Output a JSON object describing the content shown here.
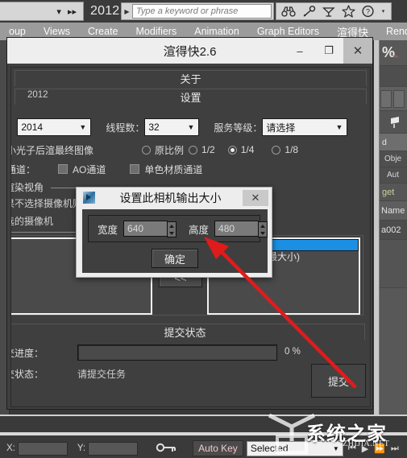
{
  "max_titlebar": {
    "file_name": "2012.max",
    "search_placeholder": "Type a keyword or phrase",
    "icons": [
      "binoculars-icon",
      "wrench-icon",
      "satellite-dish-icon",
      "star-icon",
      "help-icon"
    ]
  },
  "menubar": {
    "items": [
      "oup",
      "Views",
      "Create",
      "Modifiers",
      "Animation",
      "Graph Editors",
      "渲得快",
      "Rend"
    ]
  },
  "app_dialog": {
    "title": "渲得快2.6",
    "window_buttons": {
      "minimize": "–",
      "maximize": "❐",
      "close": "✕"
    },
    "groups": {
      "about": "关于",
      "settings": "设置",
      "submit_status": "提交状态"
    },
    "about": {
      "label": ":",
      "version": "2012"
    },
    "settings": {
      "version_label": ":",
      "version_value": "2014",
      "threads_label": "线程数：",
      "threads_value": "32",
      "service_label": "服务等级：",
      "service_value": "请选择",
      "photon_label": "小光子后渲最终图像",
      "scale_options": [
        "原比例",
        "1/2",
        "1/4",
        "1/8"
      ],
      "scale_selected": "1/4",
      "channel_label": "通道：",
      "channel_ao": "AO通道",
      "channel_mono": "单色材质通道"
    },
    "render_view": {
      "header": "渲染视角",
      "note1": "果不选择摄像机则",
      "note2": "选的摄像机",
      "btn_add": ">>",
      "btn_remove": "<<",
      "selected_cameras": [
        "小)",
        "Camera003 (最大小)"
      ]
    },
    "submit": {
      "progress_label": "交进度：",
      "progress_percent": "0 %",
      "status_label": "交状态：",
      "status_value": "请提交任务",
      "submit_button": "提交"
    }
  },
  "modal": {
    "title": "设置此相机输出大小",
    "close": "✕",
    "width_label": "宽度",
    "width_value": "640",
    "height_label": "高度",
    "height_value": "480",
    "ok_button": "确定"
  },
  "right_panel": {
    "percent": "%",
    "magnet": "⛓",
    "object_label": "Obje",
    "auto_label": "Aut",
    "get_label": "get",
    "name_label": "Name",
    "name_value": "a002",
    "d_label": "d"
  },
  "status_bar": {
    "x_label": "X:",
    "y_label": "Y:",
    "x_value": "",
    "y_value": "",
    "auto_key": "Auto Key",
    "selection": "Selected",
    "key_icon": "key-icon"
  },
  "watermark": {
    "text": "系统之家",
    "sub": "XITONGZHIJIA.NET"
  },
  "colors": {
    "accent_blue": "#1a8fe3",
    "arrow_red": "#e01b1b",
    "dialog_bg": "#3f3f3f",
    "titlebar_light": "#eeeeee",
    "menubar": "#9b9b9b"
  }
}
